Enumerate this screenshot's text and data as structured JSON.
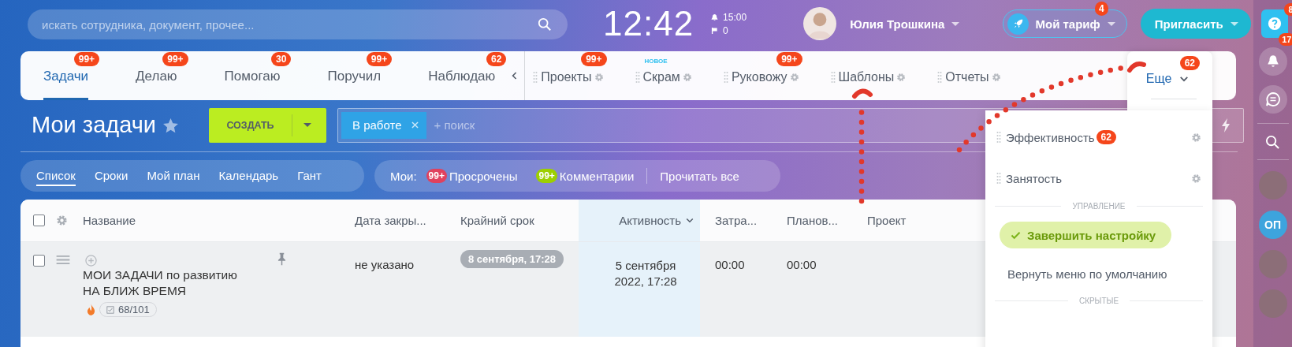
{
  "search": {
    "placeholder": "искать сотрудника, документ, прочее..."
  },
  "clock": {
    "time": "12:42",
    "alarm": "15:00",
    "flags": "0"
  },
  "user": {
    "name": "Юлия Трошкина"
  },
  "tariff": {
    "label": "Мой тариф",
    "badge": "4"
  },
  "invite": {
    "label": "Пригласить"
  },
  "rail": {
    "help_badge": "8",
    "bell_badge": "17",
    "avatars": [
      {
        "kind": "photo"
      },
      {
        "kind": "initials",
        "initials": "ОП"
      },
      {
        "kind": "photo"
      },
      {
        "kind": "photo"
      }
    ]
  },
  "tabs": [
    {
      "label": "Задачи",
      "badge": "99+",
      "selected": true
    },
    {
      "label": "Делаю",
      "badge": "99+",
      "selected": false
    },
    {
      "label": "Помогаю",
      "badge": "30",
      "selected": false
    },
    {
      "label": "Поручил",
      "badge": "99+",
      "selected": false
    },
    {
      "label": "Наблюдаю",
      "badge": "62",
      "selected": false
    }
  ],
  "pinned_tabs": [
    {
      "label": "Проекты",
      "badge": "99+"
    },
    {
      "label": "Скрам",
      "note": "НОВОЕ"
    },
    {
      "label": "Руковожу",
      "badge": "99+"
    },
    {
      "label": "Шаблоны"
    },
    {
      "label": "Отчеты"
    }
  ],
  "more": {
    "label": "Еще",
    "badge": "62"
  },
  "menu": {
    "items": [
      {
        "label": "Эффективность",
        "badge": "62"
      },
      {
        "label": "Занятость"
      }
    ],
    "section": "УПРАВЛЕНИЕ",
    "finish": "Завершить настройку",
    "reset": "Вернуть меню по умолчанию",
    "hidden_section": "СКРЫТЫЕ"
  },
  "page": {
    "title": "Мои задачи",
    "create": "СОЗДАТЬ",
    "filter": {
      "chip": "В работе",
      "placeholder": "+ поиск"
    }
  },
  "views": [
    {
      "label": "Список",
      "selected": true
    },
    {
      "label": "Сроки",
      "selected": false
    },
    {
      "label": "Мой план",
      "selected": false
    },
    {
      "label": "Календарь",
      "selected": false
    },
    {
      "label": "Гант",
      "selected": false
    }
  ],
  "counters": {
    "label": "Мои:",
    "items": [
      {
        "count": "99+",
        "label": "Просрочены",
        "color": "#e0415e"
      },
      {
        "count": "99+",
        "label": "Комментарии",
        "color": "#9dcf00"
      }
    ],
    "read_all": "Прочитать все"
  },
  "table": {
    "checked": false,
    "columns": [
      {
        "label": "Название",
        "sorted": false
      },
      {
        "label": "Дата закры...",
        "sorted": false
      },
      {
        "label": "Крайний срок",
        "sorted": false
      },
      {
        "label": "Активность",
        "sorted": true
      },
      {
        "label": "Затра...",
        "sorted": false
      },
      {
        "label": "Планов...",
        "sorted": false
      },
      {
        "label": "Проект",
        "sorted": false
      }
    ],
    "rows": [
      {
        "checked": false,
        "pinned": true,
        "title": "МОИ ЗАДАЧИ по развитию НА БЛИЖ ВРЕМЯ",
        "checklist": "68/101",
        "closed": "не указано",
        "deadline": "8 сентября, 17:28",
        "activity": "5 сентября 2022, 17:28",
        "spent": "00:00",
        "planned": "00:00"
      }
    ]
  }
}
